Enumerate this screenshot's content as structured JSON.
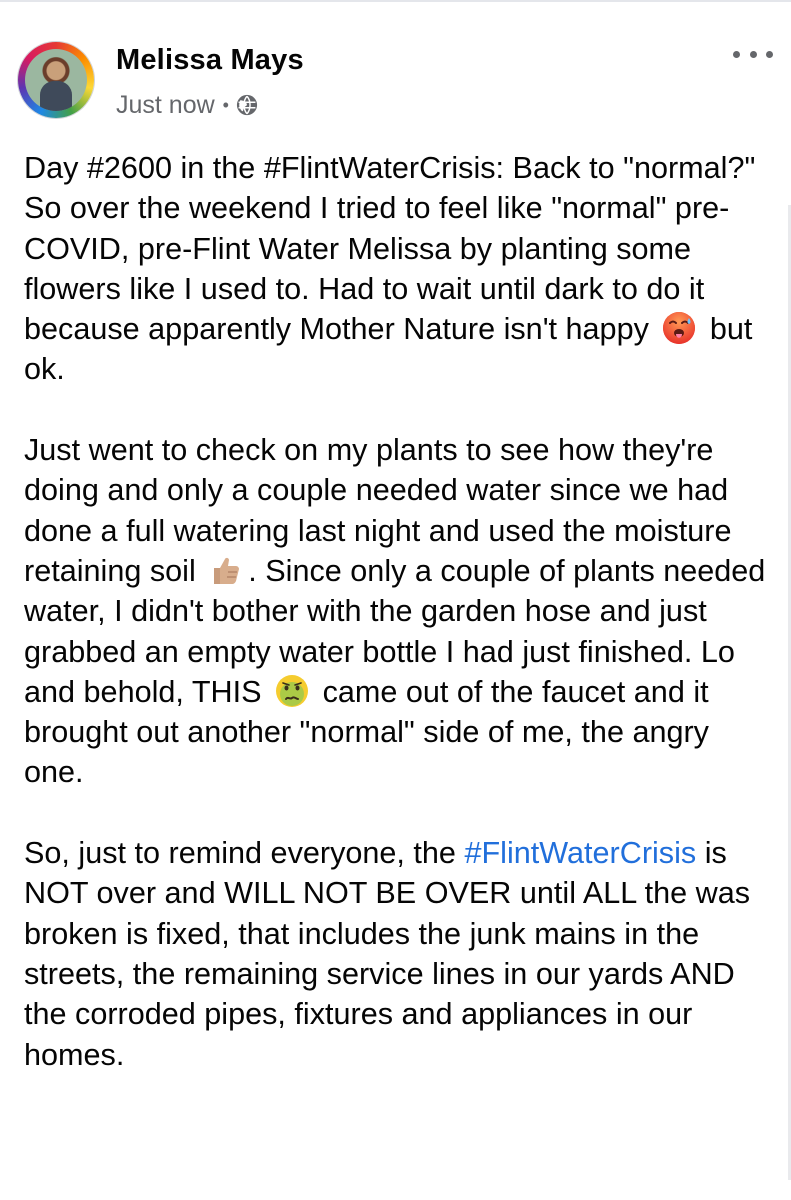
{
  "post": {
    "author": "Melissa Mays",
    "timestamp": "Just now",
    "separator": "•",
    "audience_icon": "globe-icon",
    "menu_icon": "more-options-icon",
    "avatar_icon": "profile-photo",
    "paragraphs": {
      "p1": {
        "line1": "Day #2600 in the #FlintWaterCrisis: Back to \"normal?\"",
        "line2": "So over the weekend I tried to feel like \"normal\" pre-COVID, pre-Flint Water Melissa by planting some flowers like I used to. Had to wait until dark to do it because apparently Mother Nature isn't happy",
        "emoji": "hot-face-emoji",
        "after_emoji": "but ok."
      },
      "p2": {
        "before_thumb": "Just went to check on my plants to see how they're doing and only a couple needed water since we had done a full watering last night and used the moisture retaining soil",
        "thumb_emoji": "thumbs-up-emoji",
        "between": ". Since only a couple of plants needed water, I didn't bother with the garden hose and just grabbed an empty water bottle I had just finished. Lo and behold, THIS",
        "nauseated_emoji": "nauseated-face-emoji",
        "after": "came out of the faucet and it brought out another \"normal\" side of me, the angry one."
      },
      "p3": {
        "before_link": "So, just to remind everyone, the",
        "hashtag": "#FlintWaterCrisis",
        "after_link": "is NOT over and WILL NOT BE OVER until ALL the was broken is fixed, that includes the junk mains in the streets, the remaining service lines in our yards AND the corroded pipes, fixtures and appliances in our homes."
      }
    },
    "colors": {
      "link": "#216fdb",
      "secondary_text": "#65676b",
      "body_text": "#050505"
    }
  }
}
